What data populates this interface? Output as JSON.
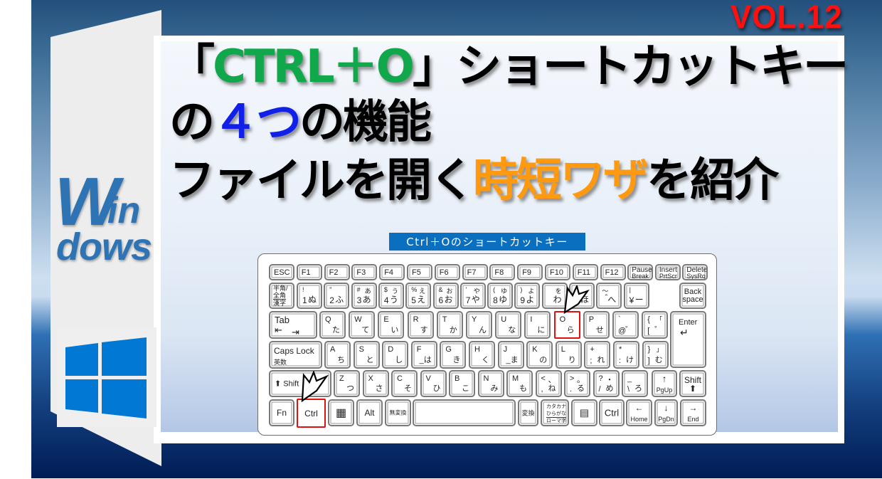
{
  "vol_label": "VOL.12",
  "title": {
    "line1": {
      "open_bracket": "「",
      "keys": "CTRL＋O",
      "close_bracket": "」",
      "rest": "ショートカットキー"
    },
    "line2": {
      "prefix": "の",
      "number": "４つ",
      "suffix": "の機能"
    },
    "line3": {
      "prefix": "ファイルを開く",
      "highlight": "時短ワザ",
      "suffix": "を紹介"
    }
  },
  "side": {
    "logo_text_1": "W",
    "logo_text_2": "in",
    "logo_text_3": "dows",
    "logo_icon": "windows-logo-icon"
  },
  "banner": "Ctrl＋Oのショートカットキー",
  "colors": {
    "green": "#10a84a",
    "blue": "#1020e8",
    "orange": "#ff9a10",
    "red": "#ff1010",
    "banner": "#0b6fc0",
    "windows_blue": "#0078d4"
  },
  "highlighted_keys": [
    "Ctrl",
    "O"
  ],
  "keyboard": {
    "row_fn": [
      "ESC",
      "F1",
      "F2",
      "F3",
      "F4",
      "F5",
      "F6",
      "F7",
      "F8",
      "F9",
      "F10",
      "F11",
      "F12"
    ],
    "pause": [
      "Pause",
      "Break"
    ],
    "insert": [
      "Insert",
      "PrtScr"
    ],
    "delete": [
      "Delete",
      "SysRq"
    ],
    "hankaku": [
      "半角/",
      "全角",
      "漢字"
    ],
    "row_num": [
      {
        "tl": "!",
        "bl": "1",
        "br": "ぬ",
        "tr": ""
      },
      {
        "tl": "\"",
        "bl": "2",
        "br": "ふ",
        "tr": ""
      },
      {
        "tl": "#",
        "bl": "3",
        "br": "あ",
        "tr": "あ"
      },
      {
        "tl": "$",
        "bl": "4",
        "br": "う",
        "tr": "う"
      },
      {
        "tl": "%",
        "bl": "5",
        "br": "え",
        "tr": "え"
      },
      {
        "tl": "&",
        "bl": "6",
        "br": "お",
        "tr": "お"
      },
      {
        "tl": "'",
        "bl": "7",
        "br": "や",
        "tr": "や"
      },
      {
        "tl": "(",
        "bl": "8",
        "br": "ゆ",
        "tr": "ゆ"
      },
      {
        "tl": ")",
        "bl": "9",
        "br": "よ",
        "tr": "よ"
      },
      {
        "tl": "",
        "bl": "",
        "br": "わ",
        "tr": "を"
      },
      {
        "tl": "=",
        "bl": "ー",
        "br": "ほ",
        "tr": ""
      },
      {
        "tl": "～",
        "bl": "＾",
        "br": "へ",
        "tr": ""
      },
      {
        "tl": "|",
        "bl": "¥",
        "br": "ー",
        "tr": ""
      }
    ],
    "backspace": [
      "Back",
      "space"
    ],
    "tab": "Tab",
    "row_q": [
      {
        "l": "Q",
        "k": "た"
      },
      {
        "l": "W",
        "k": "て"
      },
      {
        "l": "E",
        "k": "い"
      },
      {
        "l": "R",
        "k": "す"
      },
      {
        "l": "T",
        "k": "か"
      },
      {
        "l": "Y",
        "k": "ん"
      },
      {
        "l": "U",
        "k": "な"
      },
      {
        "l": "I",
        "k": "に"
      },
      {
        "l": "O",
        "k": "ら"
      },
      {
        "l": "P",
        "k": "せ"
      },
      {
        "l": "`",
        "k": "゛",
        "bl": "@"
      },
      {
        "l": "{",
        "k": "゜",
        "bl": "[",
        "tr": "「"
      }
    ],
    "enter": "Enter",
    "caps": [
      "Caps Lock",
      "英数"
    ],
    "row_a": [
      {
        "l": "A",
        "k": "ち"
      },
      {
        "l": "S",
        "k": "と"
      },
      {
        "l": "D",
        "k": "し"
      },
      {
        "l": "F",
        "k": "_は"
      },
      {
        "l": "G",
        "k": "き"
      },
      {
        "l": "H",
        "k": "く"
      },
      {
        "l": "J",
        "k": "_ま"
      },
      {
        "l": "K",
        "k": "の"
      },
      {
        "l": "L",
        "k": "り"
      },
      {
        "l": "+",
        "k": "れ",
        "bl": ";"
      },
      {
        "l": "*",
        "k": "け",
        "bl": ":"
      },
      {
        "l": "}",
        "k": "む",
        "bl": "]",
        "tr": "」"
      }
    ],
    "shift": "Shift",
    "row_z": [
      {
        "l": "Z",
        "k": "つ"
      },
      {
        "l": "X",
        "k": "さ"
      },
      {
        "l": "C",
        "k": "そ"
      },
      {
        "l": "V",
        "k": "ひ"
      },
      {
        "l": "B",
        "k": "こ"
      },
      {
        "l": "N",
        "k": "み"
      },
      {
        "l": "M",
        "k": "も"
      },
      {
        "l": "<",
        "k": "ね",
        "bl": ",",
        "tr": "、"
      },
      {
        "l": ">",
        "k": "る",
        "bl": ".",
        "tr": "。"
      },
      {
        "l": "?",
        "k": "め",
        "bl": "/",
        "tr": "・"
      },
      {
        "l": "_",
        "k": "ろ",
        "bl": "\\"
      }
    ],
    "pgup": "PgUp",
    "shift_r": "Shift",
    "fn": "Fn",
    "ctrl": "Ctrl",
    "alt": "Alt",
    "muhenkan": "無変換",
    "henkan": "変換",
    "kana": [
      "カタカナ",
      "ひらがな",
      "ローマ字"
    ],
    "ctrl_r": "Ctrl",
    "home": "Home",
    "pgdn": "PgDn",
    "end": "End"
  }
}
